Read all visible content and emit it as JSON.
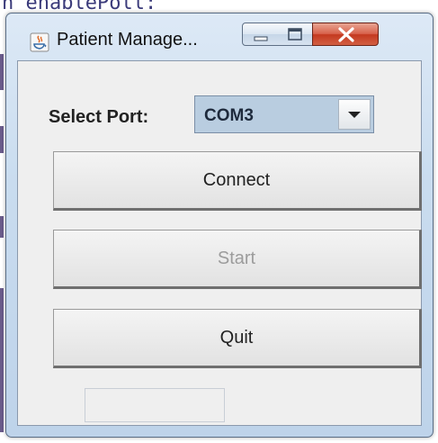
{
  "background": {
    "code_text": "n enablePoll:"
  },
  "window": {
    "title": "Patient Manage...",
    "controls": {
      "minimize": "minimize-icon",
      "maximize": "maximize-icon",
      "close": "close-icon"
    },
    "app_icon": "java-icon"
  },
  "form": {
    "port_label": "Select Port:",
    "port_value": "COM3",
    "buttons": {
      "connect": "Connect",
      "start": "Start",
      "quit": "Quit"
    },
    "status_text": ""
  },
  "colors": {
    "combo_selected_bg": "#b9cde0",
    "close_button": "#c4391f",
    "disabled_text": "#9c9c9c"
  }
}
